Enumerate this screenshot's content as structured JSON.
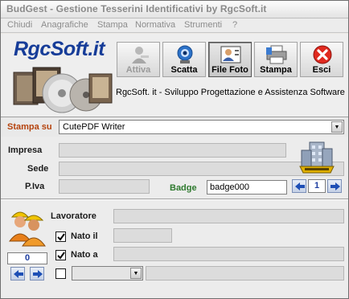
{
  "window": {
    "title": "BudGest - Gestione Tesserini Identificativi by RgcSoft.it"
  },
  "menu": [
    "Chiudi",
    "Anagrafiche",
    "Stampa",
    "Normativa",
    "Strumenti",
    "?"
  ],
  "header": {
    "logo": "RgcSoft.it",
    "tagline": "RgcSoft. it - Sviluppo Progettazione e Assistenza Software"
  },
  "toolbar": [
    {
      "label": "Attiva",
      "icon": "key-user-icon",
      "enabled": false
    },
    {
      "label": "Scatta",
      "icon": "webcam-icon",
      "enabled": true
    },
    {
      "label": "File Foto",
      "icon": "id-photo-icon",
      "enabled": true,
      "pressed": true
    },
    {
      "label": "Stampa",
      "icon": "printer-icon",
      "enabled": true
    },
    {
      "label": "Esci",
      "icon": "exit-x-icon",
      "enabled": true
    }
  ],
  "print": {
    "label": "Stampa su",
    "printer": "CutePDF Writer"
  },
  "company": {
    "impresa_label": "Impresa",
    "impresa_value": "",
    "sede_label": "Sede",
    "sede_value": "",
    "piva_label": "P.Iva",
    "piva_value": "",
    "badge_label": "Badge",
    "badge_value": "badge000",
    "company_index": "1"
  },
  "worker": {
    "lavoratore_label": "Lavoratore",
    "lavoratore_value": "",
    "nato_il_label": "Nato il",
    "nato_il_checked": true,
    "nato_il_value": "",
    "nato_a_label": "Nato a",
    "nato_a_checked": true,
    "nato_a_value": "",
    "extra_checked": false,
    "extra_select": "",
    "extra_value": "",
    "worker_index": "0"
  }
}
